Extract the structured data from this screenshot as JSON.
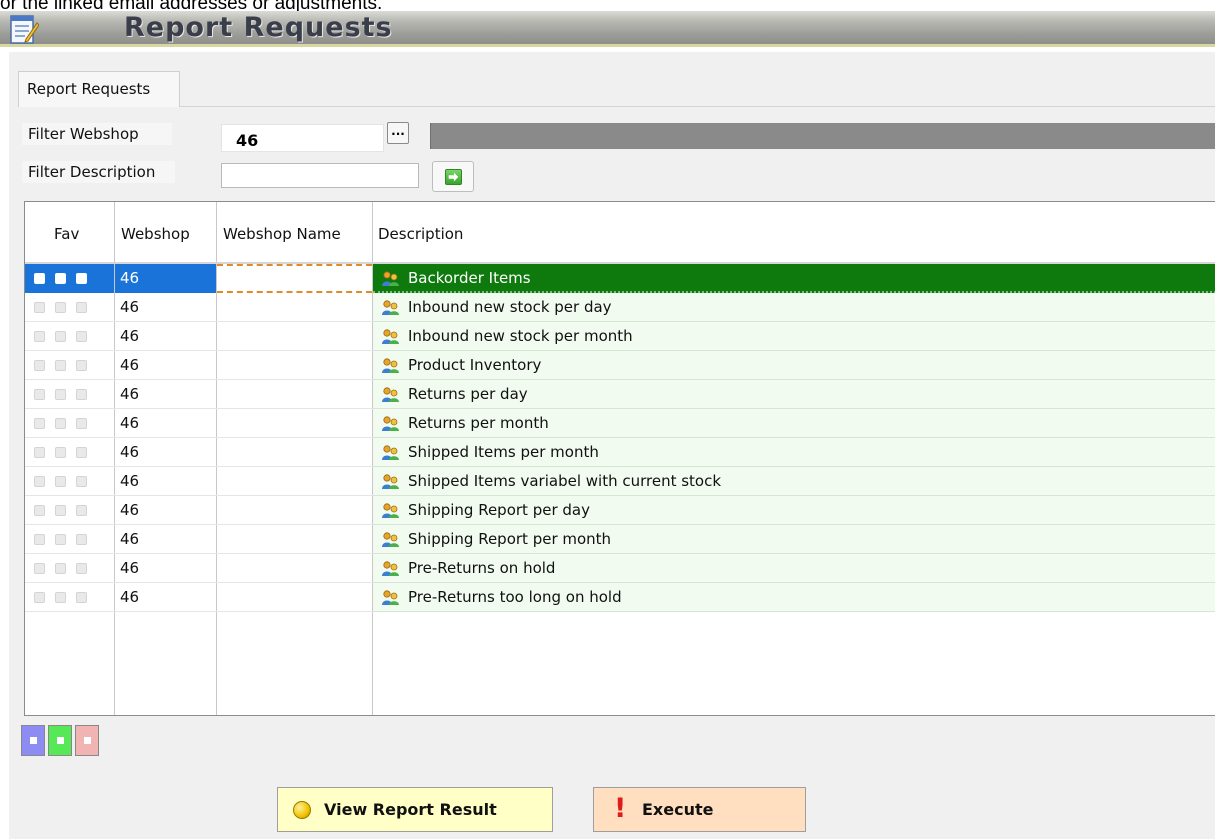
{
  "top_caption": "or the linked email addresses or adjustments.",
  "window": {
    "title": "Report Requests"
  },
  "tabs": [
    {
      "label": "Report Requests"
    }
  ],
  "filters": {
    "webshop_label": "Filter Webshop",
    "webshop_value": "46",
    "browse_label": "...",
    "description_label": "Filter Description",
    "description_value": ""
  },
  "grid": {
    "columns": [
      "Fav",
      "Webshop",
      "Webshop Name",
      "Description"
    ],
    "rows": [
      {
        "webshop": "46",
        "webshop_name": "",
        "description": "Backorder Items",
        "selected": true
      },
      {
        "webshop": "46",
        "webshop_name": "",
        "description": "Inbound new stock per day"
      },
      {
        "webshop": "46",
        "webshop_name": "",
        "description": "Inbound new stock per month"
      },
      {
        "webshop": "46",
        "webshop_name": "",
        "description": "Product Inventory"
      },
      {
        "webshop": "46",
        "webshop_name": "",
        "description": "Returns per day"
      },
      {
        "webshop": "46",
        "webshop_name": "",
        "description": "Returns per month"
      },
      {
        "webshop": "46",
        "webshop_name": "",
        "description": "Shipped Items per month"
      },
      {
        "webshop": "46",
        "webshop_name": "",
        "description": "Shipped Items variabel with current stock"
      },
      {
        "webshop": "46",
        "webshop_name": "",
        "description": "Shipping Report per day"
      },
      {
        "webshop": "46",
        "webshop_name": "",
        "description": "Shipping Report per month"
      },
      {
        "webshop": "46",
        "webshop_name": "",
        "description": "Pre-Returns on hold"
      },
      {
        "webshop": "46",
        "webshop_name": "",
        "description": "Pre-Returns too long on hold"
      }
    ]
  },
  "nav_buttons": [
    {
      "icon": "add-record-icon",
      "color": "#8c8cf2"
    },
    {
      "icon": "edit-record-icon",
      "color": "#57e857"
    },
    {
      "icon": "delete-record-icon",
      "color": "#f2b3b3"
    }
  ],
  "actions": {
    "view_label": "View Report Result",
    "execute_label": "Execute"
  },
  "colors": {
    "selected_row": "#1a73d9",
    "selected_description": "#0e7a0e",
    "view_button": "#ffffc6",
    "execute_button": "#ffdfbf"
  }
}
